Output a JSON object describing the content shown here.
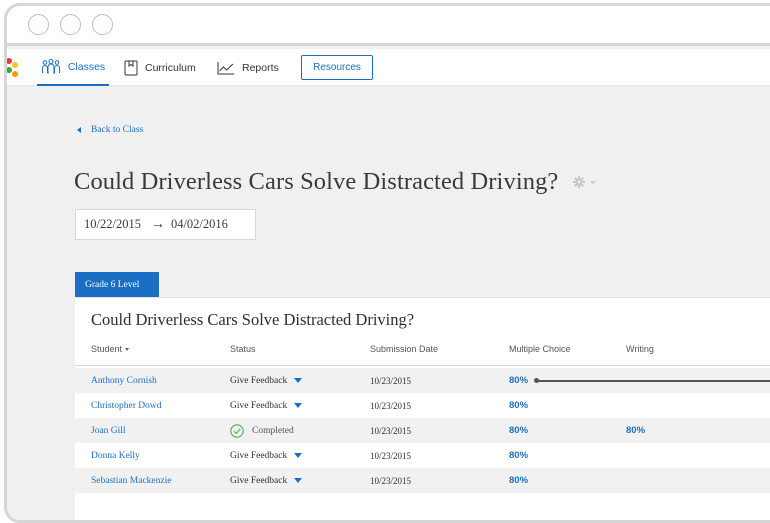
{
  "nav": {
    "classes": "Classes",
    "curriculum": "Curriculum",
    "reports": "Reports",
    "resources": "Resources"
  },
  "back_label": "Back to Class",
  "title": "Could Driverless Cars Solve Distracted Driving?",
  "date_range": {
    "start": "10/22/2015",
    "arrow": "→",
    "end": "04/02/2016"
  },
  "grade_tab": "Grade 6 Level",
  "card_title": "Could Driverless Cars Solve Distracted Driving?",
  "columns": {
    "student": "Student",
    "status": "Status",
    "submission_date": "Submission Date",
    "multiple_choice": "Multiple Choice",
    "writing": "Writing"
  },
  "rows": [
    {
      "student": "Anthony Cornish",
      "status": "Give Feedback",
      "date": "10/23/2015",
      "mc": "80%",
      "writing": ""
    },
    {
      "student": "Christopher Dowd",
      "status": "Give Feedback",
      "date": "10/23/2015",
      "mc": "80%",
      "writing": ""
    },
    {
      "student": "Joan Gill",
      "status": "Completed",
      "date": "10/23/2015",
      "mc": "80%",
      "writing": "80%"
    },
    {
      "student": "Donna Kelly",
      "status": "Give Feedback",
      "date": "10/23/2015",
      "mc": "80%",
      "writing": ""
    },
    {
      "student": "Sebastian Mackenzie",
      "status": "Give Feedback",
      "date": "10/23/2015",
      "mc": "80%",
      "writing": ""
    }
  ],
  "colors": {
    "accent": "#1a6fc4",
    "completed": "#4caf50",
    "logo": [
      "#e53935",
      "#fbc02d",
      "#43a047",
      "#ff9800"
    ]
  }
}
